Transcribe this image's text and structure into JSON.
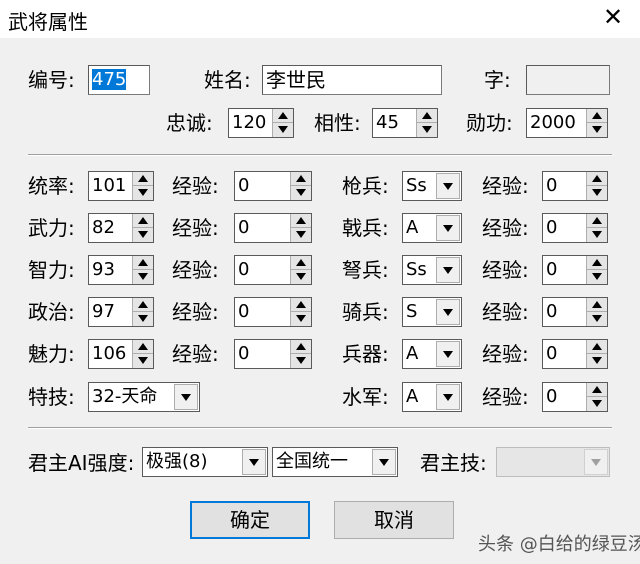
{
  "window": {
    "title": "武将属性",
    "close": "✕"
  },
  "header": {
    "id_label": "编号:",
    "id_value": "475",
    "name_label": "姓名:",
    "name_value": "李世民",
    "zi_label": "字:",
    "zi_value": "",
    "loyalty_label": "忠诚:",
    "loyalty_value": "120",
    "affinity_label": "相性:",
    "affinity_value": "45",
    "merit_label": "勋功:",
    "merit_value": "2000"
  },
  "stats": [
    {
      "label": "统率:",
      "value": "101",
      "exp_label": "经验:",
      "exp_value": "0"
    },
    {
      "label": "武力:",
      "value": "82",
      "exp_label": "经验:",
      "exp_value": "0"
    },
    {
      "label": "智力:",
      "value": "93",
      "exp_label": "经验:",
      "exp_value": "0"
    },
    {
      "label": "政治:",
      "value": "97",
      "exp_label": "经验:",
      "exp_value": "0"
    },
    {
      "label": "魅力:",
      "value": "106",
      "exp_label": "经验:",
      "exp_value": "0"
    }
  ],
  "skill": {
    "label": "特技:",
    "value": "32-天命"
  },
  "troops": [
    {
      "label": "枪兵:",
      "value": "Ss",
      "exp_label": "经验:",
      "exp_value": "0"
    },
    {
      "label": "戟兵:",
      "value": "A",
      "exp_label": "经验:",
      "exp_value": "0"
    },
    {
      "label": "弩兵:",
      "value": "Ss",
      "exp_label": "经验:",
      "exp_value": "0"
    },
    {
      "label": "骑兵:",
      "value": "S",
      "exp_label": "经验:",
      "exp_value": "0"
    },
    {
      "label": "兵器:",
      "value": "A",
      "exp_label": "经验:",
      "exp_value": "0"
    },
    {
      "label": "水军:",
      "value": "A",
      "exp_label": "经验:",
      "exp_value": "0"
    }
  ],
  "ai": {
    "label": "君主AI强度:",
    "strength": "极强(8)",
    "goal": "全国统一",
    "lord_skill_label": "君主技:",
    "lord_skill_value": ""
  },
  "buttons": {
    "ok": "确定",
    "cancel": "取消"
  },
  "watermark": "头条 @白给的绿豆汤"
}
